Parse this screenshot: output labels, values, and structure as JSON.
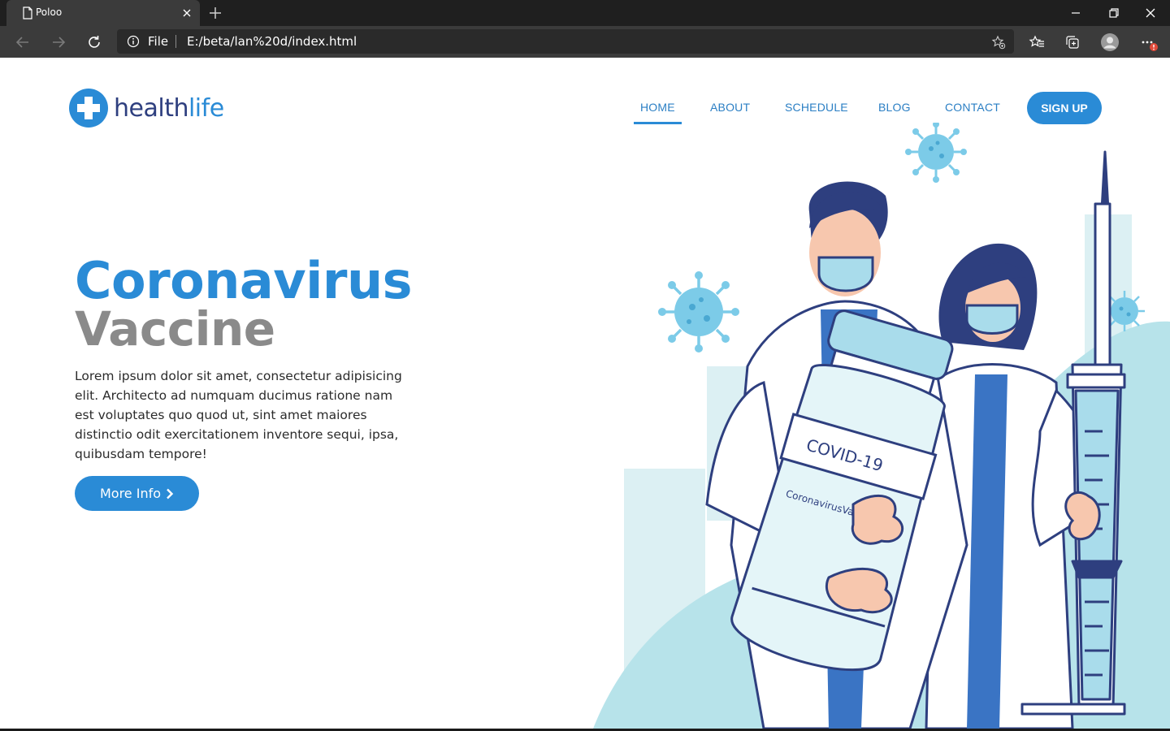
{
  "browser": {
    "tab_title": "Poloo",
    "address_scheme": "File",
    "address_url": "E:/beta/lan%20d/index.html",
    "theme_colors": {
      "tabbar": "#1f1f1f",
      "toolbar": "#3b3b3b",
      "addressbar": "#2a2a2a"
    },
    "icons": [
      "page-icon",
      "close-icon",
      "plus-icon",
      "minimize-icon",
      "restore-icon",
      "back-icon",
      "forward-icon",
      "refresh-icon",
      "info-icon",
      "add-favorite-icon",
      "favorites-icon",
      "collections-icon",
      "profile-icon",
      "more-icon"
    ]
  },
  "site": {
    "logo": {
      "part1": "health",
      "part2": "life"
    },
    "nav": {
      "items": [
        {
          "label": "HOME",
          "active": true
        },
        {
          "label": "ABOUT",
          "active": false
        },
        {
          "label": "SCHEDULE",
          "active": false
        },
        {
          "label": "BLOG",
          "active": false
        },
        {
          "label": "CONTACT",
          "active": false
        }
      ],
      "signup": "SIGN UP"
    },
    "hero": {
      "title_line1": "Coronavirus",
      "title_line2": "Vaccine",
      "body": "Lorem ipsum dolor sit amet, consectetur adipisicing elit. Architecto ad numquam ducimus ratione nam est voluptates quo quod ut, sint amet maiores distinctio odit exercitationem inventore sequi, ipsa, quibusdam tempore!",
      "button": "More Info"
    },
    "illustration": {
      "vial_label": "COVID-19",
      "vial_sublabel": "CoronavirusVacci"
    },
    "colors": {
      "primary": "#2a8bd6",
      "navy": "#2e3f7f",
      "grey_title": "#8a8a8a",
      "light_blue": "#b7e3ea",
      "virus": "#7ccbe8"
    }
  }
}
